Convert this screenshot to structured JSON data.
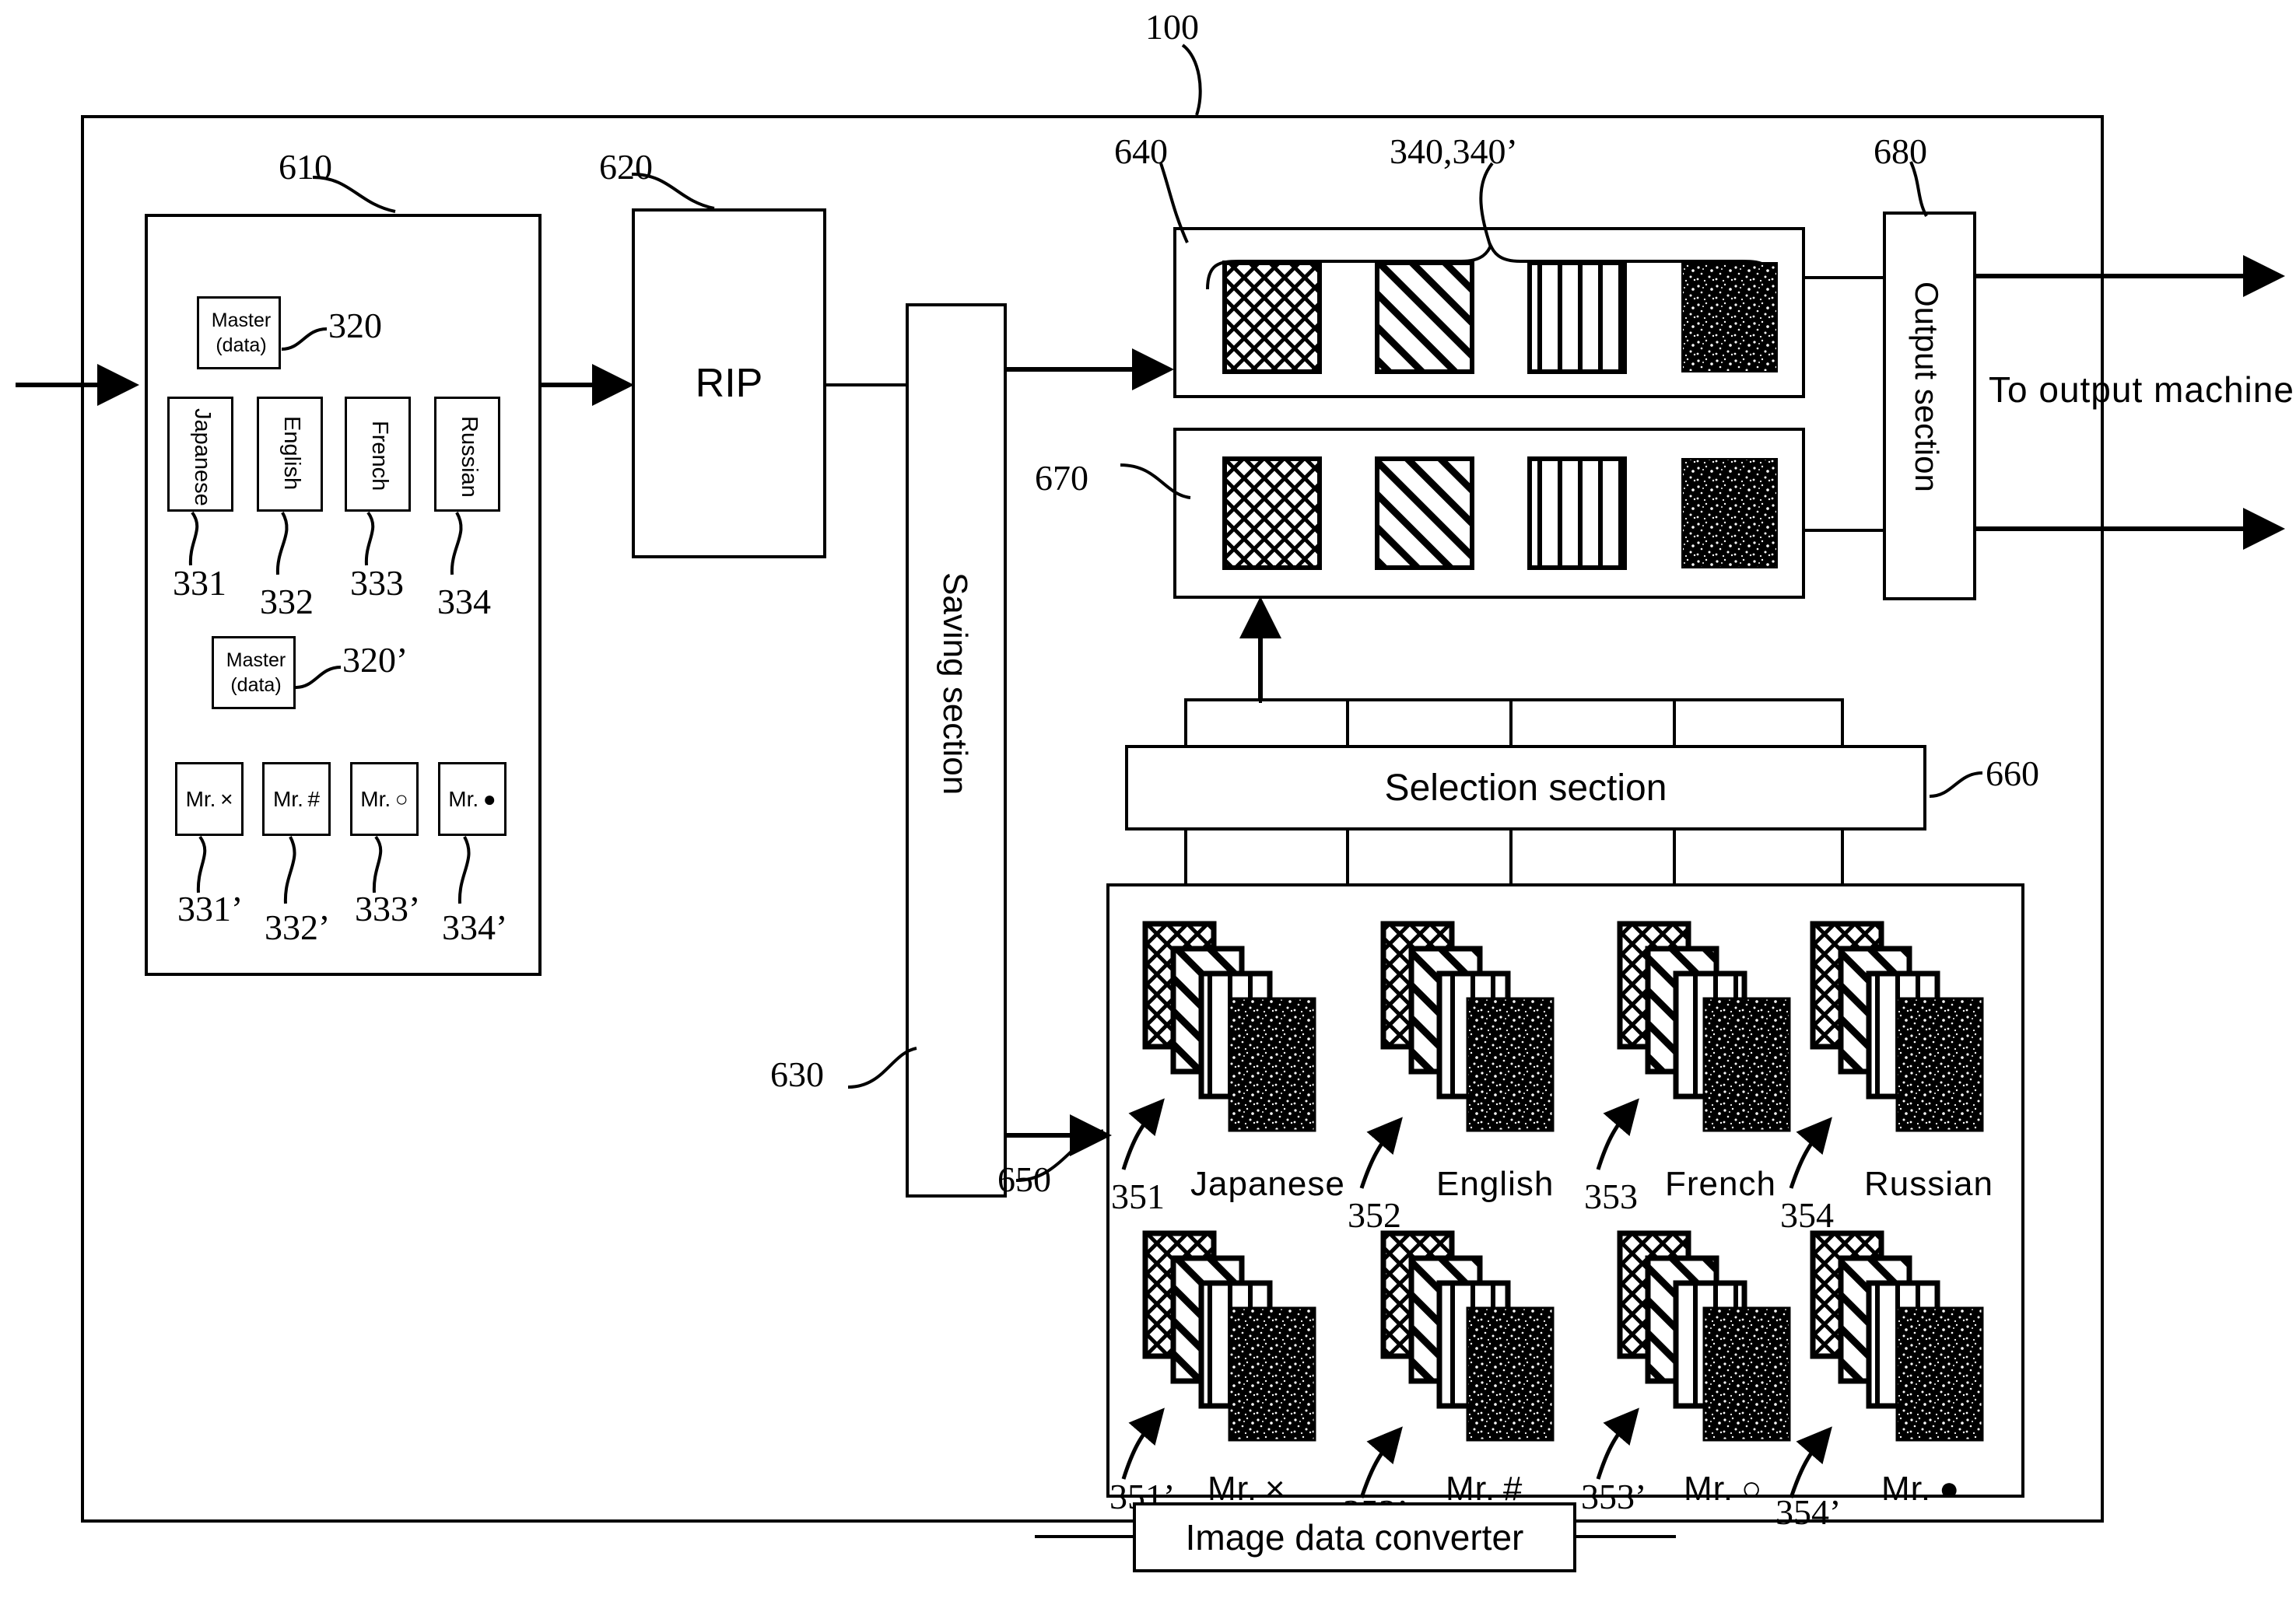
{
  "figure": {
    "system_ref": "100",
    "to_output_machine": "To output machine",
    "image_data_converter": "Image data converter"
  },
  "refs": {
    "system": "100",
    "input_section": "610",
    "rip": "620",
    "saving_section": "630",
    "output_row_top": "640",
    "converter_box": "650",
    "selection_section": "660",
    "output_row_bottom": "670",
    "output_section": "680",
    "plates_top": "340,340’",
    "master": "320",
    "master_prime": "320’"
  },
  "blocks": {
    "rip_label": "RIP",
    "saving_label": "Saving section",
    "selection_label": "Selection section",
    "output_label": "Output section",
    "master_line1": "Master",
    "master_line2": "(data)"
  },
  "language_boxes": [
    {
      "label": "Japanese",
      "ref": "331"
    },
    {
      "label": "English",
      "ref": "332"
    },
    {
      "label": "French",
      "ref": "333"
    },
    {
      "label": "Russian",
      "ref": "334"
    }
  ],
  "person_boxes": [
    {
      "label": "Mr. ×",
      "ref": "331’"
    },
    {
      "label": "Mr. #",
      "ref": "332’"
    },
    {
      "label": "Mr. ○",
      "ref": "333’"
    },
    {
      "label": "Mr. ●",
      "ref": "334’"
    }
  ],
  "plate_patterns": [
    "crosshatch",
    "diagonal",
    "vertical",
    "speckle"
  ],
  "stack_groups_top": [
    {
      "label": "Japanese",
      "ref": "351"
    },
    {
      "label": "English",
      "ref": "352"
    },
    {
      "label": "French",
      "ref": "353"
    },
    {
      "label": "Russian",
      "ref": "354"
    }
  ],
  "stack_groups_bottom": [
    {
      "label": "Mr. ×",
      "ref": "351’"
    },
    {
      "label": "Mr. #",
      "ref": "352’"
    },
    {
      "label": "Mr. ○",
      "ref": "353’"
    },
    {
      "label": "Mr. ●",
      "ref": "354’"
    }
  ],
  "colors": {
    "ink": "#000000",
    "paper": "#ffffff"
  }
}
